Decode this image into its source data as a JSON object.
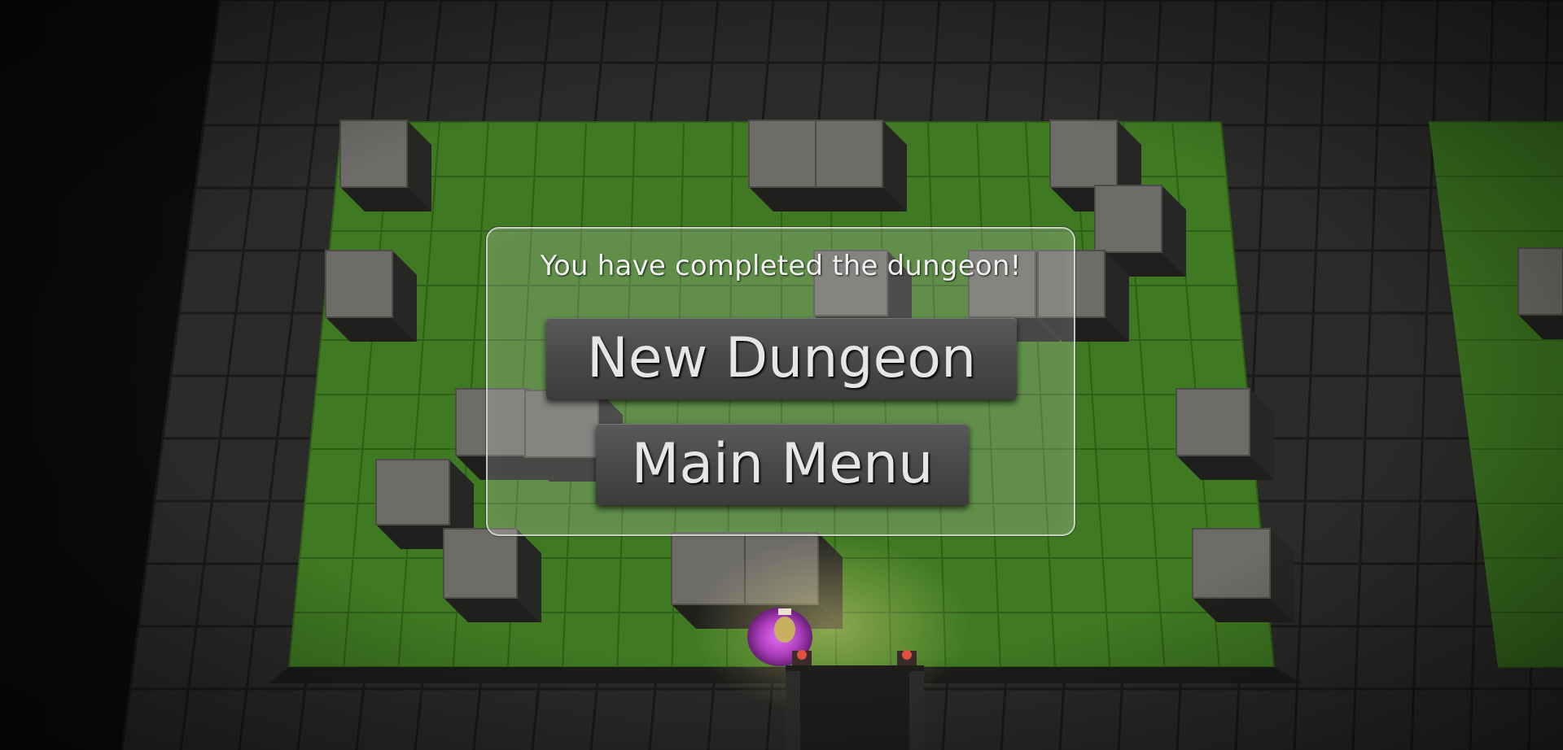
{
  "dialog": {
    "message": "You have completed the dungeon!",
    "buttons": {
      "new_dungeon": "New Dungeon",
      "main_menu": "Main Menu"
    }
  },
  "colors": {
    "floor_green": "#3f7a22",
    "stone_light": "#6e6c68",
    "stone_dark": "#2a2a28",
    "portal_magenta": "#b040c0",
    "panel_border": "#dcdcdc",
    "button_fill": "#4a4a4a",
    "text": "#f0f0f0"
  }
}
